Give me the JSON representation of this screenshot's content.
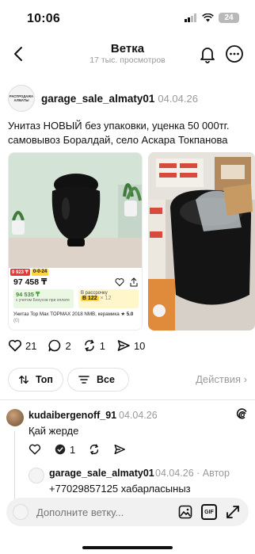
{
  "status": {
    "time": "10:06",
    "battery": "24"
  },
  "header": {
    "title": "Ветка",
    "views": "17 тыс. просмотров"
  },
  "post": {
    "avatar_text": "РАСПРОДАЖА АЛМАТЫ",
    "author": "garage_sale_almaty01",
    "date": "04.04.26",
    "text": "Унитаз НОВЫЙ без упаковки, уценка 50 000тг. самовывоз Боралдай, село Аскара Токпанова",
    "ad": {
      "badge1": "9 923 ₸",
      "badge2": "0-0-24",
      "price": "97 458 ₸",
      "bonus_value": "94 535 ₸",
      "bonus_note": "с учетом Бонусов при оплате",
      "install_label": "В рассрочку",
      "install_value": "В 122",
      "install_suffix": "× 12",
      "title": "Унитаз Top Max TOPMAX 2018 NMB, керамика",
      "rating": "★ 5.0",
      "reviews": "(0)"
    },
    "likes": "21",
    "comments": "2",
    "reposts": "1",
    "shares": "10"
  },
  "filters": {
    "top": "Топ",
    "all": "Все",
    "actions": "Действия"
  },
  "comment": {
    "author": "kudaibergenoff_91",
    "date": "04.04.26",
    "text": "Қай жерде",
    "replies": "1"
  },
  "reply": {
    "author": "garage_sale_almaty01",
    "date": "04.04.26 · Автор",
    "text": "+77029857125 хабарласыныз"
  },
  "composer": {
    "placeholder": "Дополните ветку..."
  }
}
